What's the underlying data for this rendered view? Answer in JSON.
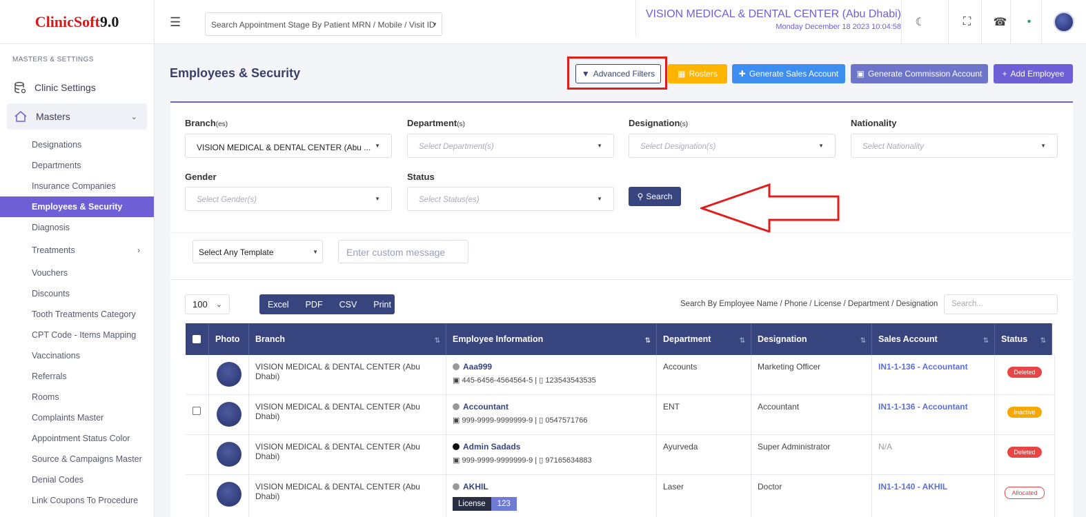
{
  "app": {
    "logo_part1": "ClinicSoft",
    "logo_part2": " 9.0"
  },
  "sidebar": {
    "section": "MASTERS & SETTINGS",
    "clinic_settings": "Clinic Settings",
    "masters": "Masters",
    "items": [
      "Designations",
      "Departments",
      "Insurance Companies",
      "Employees & Security",
      "Diagnosis",
      "Treatments",
      "Vouchers",
      "Discounts",
      "Tooth Treatments Category",
      "CPT Code - Items Mapping",
      "Vaccinations",
      "Referrals",
      "Rooms",
      "Complaints Master",
      "Appointment Status Color",
      "Source & Campaigns Master",
      "Denial Codes",
      "Link Coupons To Procedure"
    ]
  },
  "topbar": {
    "search_placeholder": "Search Appointment Stage By Patient MRN / Mobile / Visit ID",
    "clinic_name": "VISION MEDICAL & DENTAL CENTER (Abu Dhabi)",
    "datetime": "Monday December 18 2023 10:04:58"
  },
  "page": {
    "title": "Employees & Security"
  },
  "actions": {
    "advanced_filters": "Advanced Filters",
    "rosters": "Rosters",
    "generate_sales": "Generate Sales Account",
    "generate_commission": "Generate Commission Account",
    "add_employee": "Add Employee"
  },
  "filters": {
    "branch_label": "Branch",
    "branch_suffix": "(es)",
    "branch_value": "VISION MEDICAL & DENTAL CENTER (Abu ...",
    "department_label": "Department",
    "department_suffix": "(s)",
    "department_placeholder": "Select Department(s)",
    "designation_label": "Designation",
    "designation_suffix": "(s)",
    "designation_placeholder": "Select Designation(s)",
    "nationality_label": "Nationality",
    "nationality_placeholder": "Select Nationality",
    "gender_label": "Gender",
    "gender_placeholder": "Select Gender(s)",
    "status_label": "Status",
    "status_placeholder": "Select Status(es)",
    "search_button": "Search"
  },
  "template": {
    "select": "Select Any Template",
    "message_placeholder": "Enter custom message"
  },
  "table_controls": {
    "page_size": "100",
    "export": [
      "Excel",
      "PDF",
      "CSV",
      "Print"
    ],
    "search_label": "Search By Employee Name / Phone / License / Department / Designation",
    "search_placeholder": "Search..."
  },
  "table": {
    "headers": {
      "photo": "Photo",
      "branch": "Branch",
      "employee": "Employee Information",
      "department": "Department",
      "designation": "Designation",
      "sales": "Sales Account",
      "status": "Status"
    },
    "rows": [
      {
        "branch": "VISION MEDICAL & DENTAL CENTER (Abu Dhabi)",
        "name": "Aaa999",
        "id": "445-6456-4564564-5",
        "phone": "123543543535",
        "department": "Accounts",
        "designation": "Marketing Officer",
        "sales": "IN1-1-136 - Accountant",
        "status": "Deleted"
      },
      {
        "branch": "VISION MEDICAL & DENTAL CENTER (Abu Dhabi)",
        "name": "Accountant",
        "id": "999-9999-9999999-9",
        "phone": "0547571766",
        "department": "ENT",
        "designation": "Accountant",
        "sales": "IN1-1-136 - Accountant",
        "status": "Inactive"
      },
      {
        "branch": "VISION MEDICAL & DENTAL CENTER (Abu Dhabi)",
        "name": "Admin Sadads",
        "id": "999-9999-9999999-9",
        "phone": "97165634883",
        "department": "Ayurveda",
        "designation": "Super Administrator",
        "sales": "N/A",
        "status": "Deleted"
      },
      {
        "branch": "VISION MEDICAL & DENTAL CENTER (Abu Dhabi)",
        "name": "AKHIL",
        "license_label": "License",
        "license_value": "123",
        "department": "Laser",
        "designation": "Doctor",
        "sales": "IN1-1-140 - AKHIL",
        "status": "Allocated"
      }
    ]
  },
  "colors": {
    "accent": "#6e5fd6",
    "navy": "#38447e",
    "deleted": "#e84545",
    "inactive": "#f6a800",
    "rosters": "#ffb400",
    "blue": "#3d8ef0"
  }
}
